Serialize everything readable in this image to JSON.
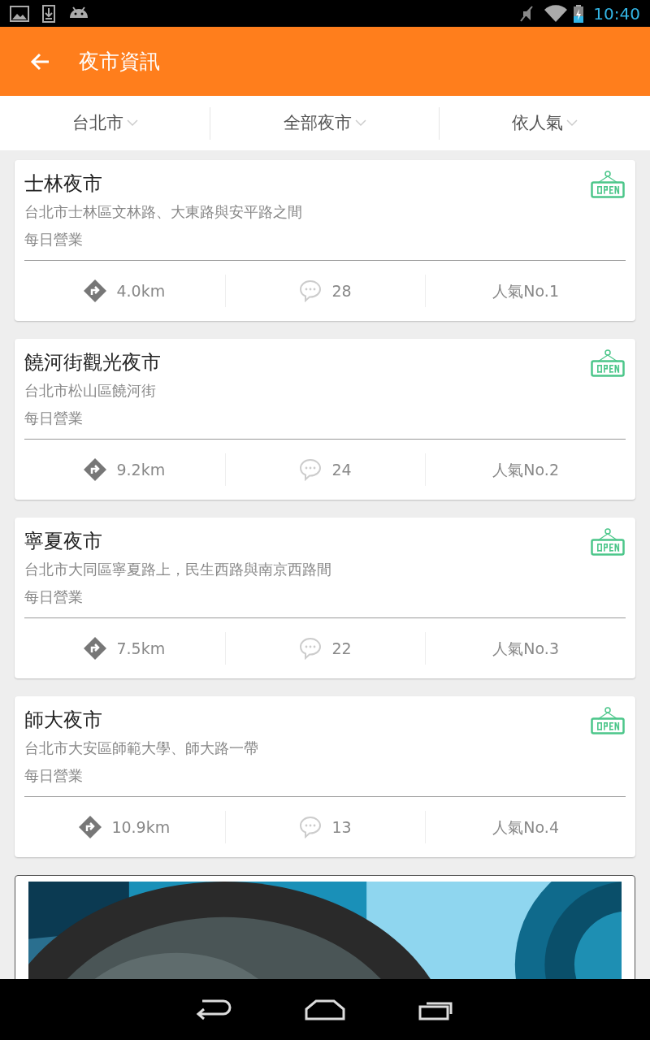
{
  "status_bar": {
    "time": "10:40"
  },
  "app_bar": {
    "title": "夜市資訊"
  },
  "filters": [
    {
      "label": "台北市"
    },
    {
      "label": "全部夜市"
    },
    {
      "label": "依人氣"
    }
  ],
  "markets": [
    {
      "name": "士林夜市",
      "address": "台北市士林區文林路、大東路與安平路之間",
      "hours": "每日營業",
      "open": true,
      "distance": "4.0km",
      "comments": "28",
      "rank": "人氣No.1"
    },
    {
      "name": "饒河街觀光夜市",
      "address": "台北市松山區饒河街",
      "hours": "每日營業",
      "open": true,
      "distance": "9.2km",
      "comments": "24",
      "rank": "人氣No.2"
    },
    {
      "name": "寧夏夜市",
      "address": "台北市大同區寧夏路上，民生西路與南京西路間",
      "hours": "每日營業",
      "open": true,
      "distance": "7.5km",
      "comments": "22",
      "rank": "人氣No.3"
    },
    {
      "name": "師大夜市",
      "address": "台北市大安區師範大學、師大路一帶",
      "hours": "每日營業",
      "open": true,
      "distance": "10.9km",
      "comments": "13",
      "rank": "人氣No.4"
    }
  ]
}
